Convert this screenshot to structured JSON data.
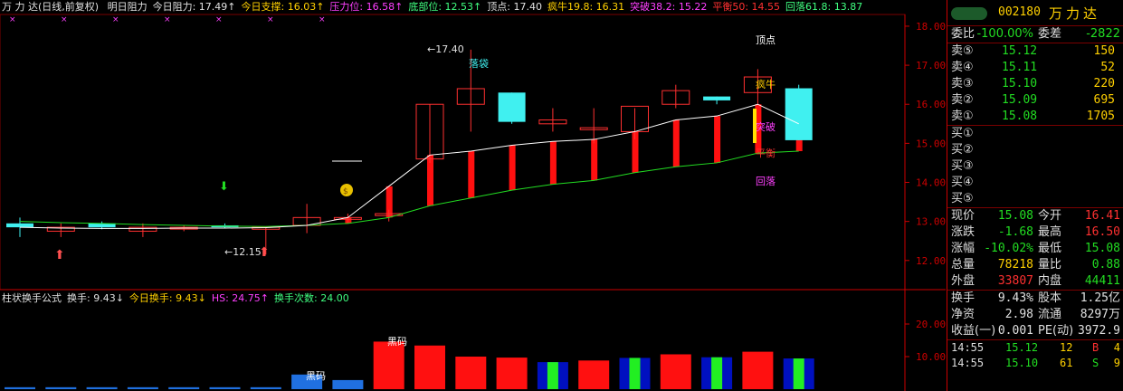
{
  "header": {
    "title": "万 力 达(日线,前复权)",
    "items": [
      {
        "label": "明日阻力",
        "color": "#e0e0e0"
      },
      {
        "label": "今日阻力: 17.49↑",
        "color": "#e0e0e0"
      },
      {
        "label": "今日支撑: 16.03↑",
        "color": "#ffd000"
      },
      {
        "label": "压力位: 16.58↑",
        "color": "#ff40ff"
      },
      {
        "label": "底部位: 12.53↑",
        "color": "#40ff80"
      },
      {
        "label": "顶点: 17.40",
        "color": "#e0e0e0"
      },
      {
        "label": "疯牛19.8: 16.31",
        "color": "#ffd000"
      },
      {
        "label": "突破38.2: 15.22",
        "color": "#ff40ff"
      },
      {
        "label": "平衡50: 14.55",
        "color": "#ff3030"
      },
      {
        "label": "回落61.8: 13.87",
        "color": "#40ff80"
      }
    ]
  },
  "subheader": {
    "items": [
      {
        "label": "柱状换手公式",
        "color": "#e0e0e0"
      },
      {
        "label": "换手: 9.43↓",
        "color": "#e0e0e0"
      },
      {
        "label": "今日换手: 9.43↓",
        "color": "#ffd000"
      },
      {
        "label": "HS: 24.75↑",
        "color": "#ff40ff"
      },
      {
        "label": "换手次数: 24.00",
        "color": "#40ff80"
      }
    ]
  },
  "axis": {
    "price_ticks": [
      "18.00",
      "17.00",
      "16.00",
      "15.00",
      "14.00",
      "13.00",
      "12.00"
    ],
    "volume_ticks": [
      "20.00",
      "10.00"
    ]
  },
  "annotations": {
    "peak_label": "17.40",
    "low_label": "12.15",
    "fall_label": "落袋",
    "level_labels": [
      {
        "text": "顶点",
        "color": "#ffffff"
      },
      {
        "text": "疯牛",
        "color": "#ffd000"
      },
      {
        "text": "突破",
        "color": "#ff40ff"
      },
      {
        "text": "平衡",
        "color": "#ff3030"
      },
      {
        "text": "回落",
        "color": "#ff40ff"
      }
    ],
    "chip_label_1": "黑码",
    "chip_label_2": "黑码",
    "money_icon": "money-bag-icon"
  },
  "chart_data": {
    "type": "candlestick",
    "title": "万 力 达(日线,前复权)",
    "ylim": [
      11.3,
      18.3
    ],
    "candles": [
      {
        "o": 12.95,
        "h": 13.1,
        "l": 12.6,
        "c": 12.85,
        "color": "cyan"
      },
      {
        "o": 12.75,
        "h": 12.95,
        "l": 12.6,
        "c": 12.85,
        "color": "red"
      },
      {
        "o": 12.95,
        "h": 13.0,
        "l": 12.8,
        "c": 12.85,
        "color": "cyan"
      },
      {
        "o": 12.75,
        "h": 12.95,
        "l": 12.6,
        "c": 12.85,
        "color": "red"
      },
      {
        "o": 12.82,
        "h": 12.9,
        "l": 12.75,
        "c": 12.85,
        "color": "red"
      },
      {
        "o": 12.9,
        "h": 12.95,
        "l": 12.82,
        "c": 12.85,
        "color": "cyan"
      },
      {
        "o": 12.8,
        "h": 12.85,
        "l": 12.15,
        "c": 12.85,
        "color": "red"
      },
      {
        "o": 12.9,
        "h": 13.45,
        "l": 12.7,
        "c": 13.1,
        "color": "red"
      },
      {
        "o": 13.1,
        "h": 13.2,
        "l": 12.95,
        "c": 13.1,
        "color": "red"
      },
      {
        "o": 13.15,
        "h": 13.3,
        "l": 13.0,
        "c": 13.2,
        "color": "red"
      },
      {
        "o": 14.6,
        "h": 16.0,
        "l": 14.5,
        "c": 16.0,
        "color": "red"
      },
      {
        "o": 16.0,
        "h": 17.4,
        "l": 15.3,
        "c": 16.4,
        "color": "red"
      },
      {
        "o": 16.3,
        "h": 16.3,
        "l": 15.5,
        "c": 15.55,
        "color": "cyan"
      },
      {
        "o": 15.5,
        "h": 15.9,
        "l": 15.3,
        "c": 15.6,
        "color": "red"
      },
      {
        "o": 15.35,
        "h": 15.9,
        "l": 15.0,
        "c": 15.4,
        "color": "red"
      },
      {
        "o": 15.3,
        "h": 15.9,
        "l": 15.1,
        "c": 15.95,
        "color": "red"
      },
      {
        "o": 16.0,
        "h": 16.5,
        "l": 15.9,
        "c": 16.35,
        "color": "red"
      },
      {
        "o": 16.2,
        "h": 16.2,
        "l": 16.0,
        "c": 16.1,
        "color": "cyan"
      },
      {
        "o": 16.3,
        "h": 16.9,
        "l": 16.0,
        "c": 16.7,
        "color": "red"
      },
      {
        "o": 16.41,
        "h": 16.5,
        "l": 15.08,
        "c": 15.08,
        "color": "cyan"
      }
    ],
    "ma_white": [
      12.85,
      12.83,
      12.82,
      12.82,
      12.83,
      12.83,
      12.84,
      12.9,
      13.1,
      13.9,
      14.7,
      14.8,
      14.95,
      15.05,
      15.1,
      15.3,
      15.6,
      15.7,
      16.0,
      15.5
    ],
    "ma_green": [
      13.0,
      12.97,
      12.95,
      12.92,
      12.9,
      12.88,
      12.87,
      12.9,
      12.95,
      13.1,
      13.4,
      13.6,
      13.8,
      13.95,
      14.05,
      14.25,
      14.4,
      14.5,
      14.75,
      14.8
    ],
    "turnover": {
      "values": [
        0.6,
        0.6,
        0.6,
        0.6,
        0.6,
        0.6,
        0.6,
        4.5,
        2.8,
        14.6,
        13.4,
        10.0,
        9.7,
        8.3,
        8.8,
        9.6,
        10.7,
        9.8,
        11.5,
        9.43
      ],
      "ylim": [
        0,
        25
      ]
    }
  },
  "quote": {
    "code": "002180",
    "name": "万力达",
    "weibi": {
      "label": "委比",
      "value": "-100.00%",
      "label2": "委差",
      "value2": "-2822"
    },
    "asks": [
      {
        "label": "卖⑤",
        "price": "15.12",
        "vol": "150"
      },
      {
        "label": "卖④",
        "price": "15.11",
        "vol": "52"
      },
      {
        "label": "卖③",
        "price": "15.10",
        "vol": "220"
      },
      {
        "label": "卖②",
        "price": "15.09",
        "vol": "695"
      },
      {
        "label": "卖①",
        "price": "15.08",
        "vol": "1705"
      }
    ],
    "bids": [
      {
        "label": "买①"
      },
      {
        "label": "买②"
      },
      {
        "label": "买③"
      },
      {
        "label": "买④"
      },
      {
        "label": "买⑤"
      }
    ],
    "stats": [
      {
        "l": "现价",
        "v": "15.08",
        "vc": "#22dd22",
        "l2": "今开",
        "v2": "16.41",
        "v2c": "#ff3030"
      },
      {
        "l": "涨跌",
        "v": "-1.68",
        "vc": "#22dd22",
        "l2": "最高",
        "v2": "16.50",
        "v2c": "#ff3030"
      },
      {
        "l": "涨幅",
        "v": "-10.02%",
        "vc": "#22dd22",
        "l2": "最低",
        "v2": "15.08",
        "v2c": "#22dd22"
      },
      {
        "l": "总量",
        "v": "78218",
        "vc": "#ffd000",
        "l2": "量比",
        "v2": "0.88",
        "v2c": "#22dd22"
      },
      {
        "l": "外盘",
        "v": "33807",
        "vc": "#ff3030",
        "l2": "内盘",
        "v2": "44411",
        "v2c": "#22dd22"
      }
    ],
    "stats2": [
      {
        "l": "换手",
        "v": "9.43%",
        "vc": "#e0e0e0",
        "l2": "股本",
        "v2": "1.25亿",
        "v2c": "#e0e0e0"
      },
      {
        "l": "净资",
        "v": "2.98",
        "vc": "#e0e0e0",
        "l2": "流通",
        "v2": "8297万",
        "v2c": "#e0e0e0"
      },
      {
        "l": "收益(一)",
        "v": "0.001",
        "vc": "#e0e0e0",
        "l2": "PE(动)",
        "v2": "3972.9",
        "v2c": "#e0e0e0"
      }
    ],
    "ticks": [
      {
        "t": "14:55",
        "p": "15.12",
        "v": "12",
        "f": "B",
        "fc": "#ff3030",
        "n": "4"
      },
      {
        "t": "14:55",
        "p": "15.10",
        "v": "61",
        "f": "S",
        "fc": "#22dd22",
        "n": "9"
      }
    ]
  }
}
